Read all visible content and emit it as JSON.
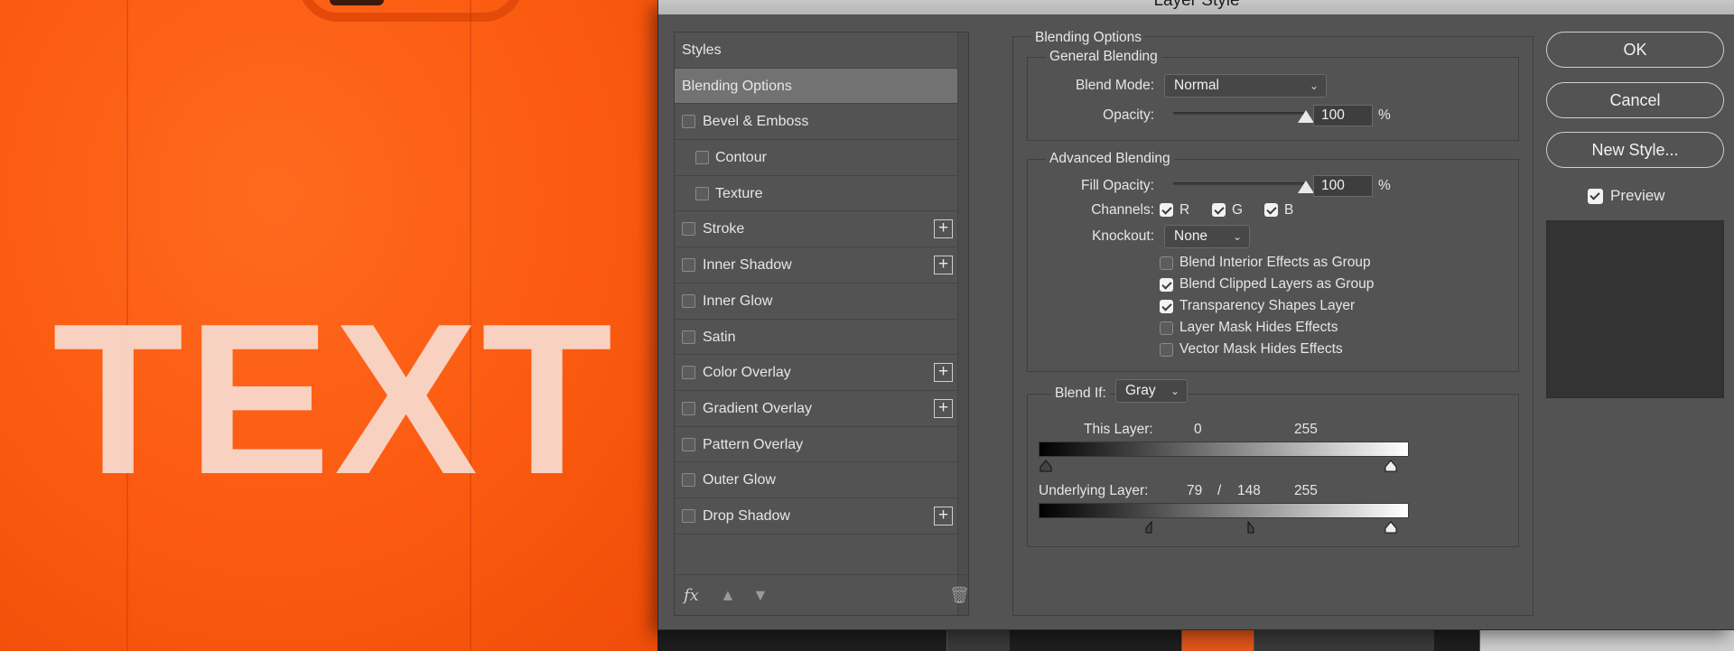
{
  "background": {
    "shirt_text": "TEXT"
  },
  "dialog": {
    "title": "Layer Style"
  },
  "styles_panel": {
    "header": "Styles",
    "selected": "Blending Options",
    "items": [
      {
        "label": "Bevel & Emboss",
        "checked": false,
        "indent": false,
        "has_add": false
      },
      {
        "label": "Contour",
        "checked": false,
        "indent": true,
        "has_add": false
      },
      {
        "label": "Texture",
        "checked": false,
        "indent": true,
        "has_add": false
      },
      {
        "label": "Stroke",
        "checked": false,
        "indent": false,
        "has_add": true
      },
      {
        "label": "Inner Shadow",
        "checked": false,
        "indent": false,
        "has_add": true
      },
      {
        "label": "Inner Glow",
        "checked": false,
        "indent": false,
        "has_add": false
      },
      {
        "label": "Satin",
        "checked": false,
        "indent": false,
        "has_add": false
      },
      {
        "label": "Color Overlay",
        "checked": false,
        "indent": false,
        "has_add": true
      },
      {
        "label": "Gradient Overlay",
        "checked": false,
        "indent": false,
        "has_add": true
      },
      {
        "label": "Pattern Overlay",
        "checked": false,
        "indent": false,
        "has_add": false
      },
      {
        "label": "Outer Glow",
        "checked": false,
        "indent": false,
        "has_add": false
      },
      {
        "label": "Drop Shadow",
        "checked": false,
        "indent": false,
        "has_add": true
      }
    ],
    "footer": {
      "fx_label": "fx",
      "add_icon": "plus-square-icon",
      "up_icon": "arrow-up-icon",
      "down_icon": "arrow-down-icon",
      "trash_icon": "trash-icon"
    }
  },
  "blending": {
    "section_title": "Blending Options",
    "general": {
      "title": "General Blending",
      "blend_mode_label": "Blend Mode:",
      "blend_mode_value": "Normal",
      "opacity_label": "Opacity:",
      "opacity_value": "100",
      "opacity_unit": "%"
    },
    "advanced": {
      "title": "Advanced Blending",
      "fill_opacity_label": "Fill Opacity:",
      "fill_opacity_value": "100",
      "fill_opacity_unit": "%",
      "channels_label": "Channels:",
      "channel_r": "R",
      "channel_g": "G",
      "channel_b": "B",
      "knockout_label": "Knockout:",
      "knockout_value": "None",
      "options": [
        {
          "label": "Blend Interior Effects as Group",
          "checked": false
        },
        {
          "label": "Blend Clipped Layers as Group",
          "checked": true
        },
        {
          "label": "Transparency Shapes Layer",
          "checked": true
        },
        {
          "label": "Layer Mask Hides Effects",
          "checked": false
        },
        {
          "label": "Vector Mask Hides Effects",
          "checked": false
        }
      ]
    },
    "blend_if": {
      "label": "Blend If:",
      "value": "Gray",
      "this_layer_label": "This Layer:",
      "this_layer_low": "0",
      "this_layer_high": "255",
      "underlying_label": "Underlying Layer:",
      "underlying_low_a": "79",
      "underlying_sep": "/",
      "underlying_low_b": "148",
      "underlying_high": "255"
    }
  },
  "buttons": {
    "ok": "OK",
    "cancel": "Cancel",
    "new_style": "New Style...",
    "preview_label": "Preview",
    "preview_checked": true
  }
}
